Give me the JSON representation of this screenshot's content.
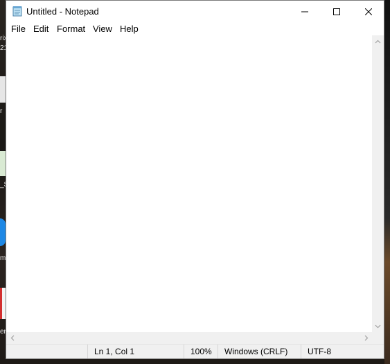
{
  "window": {
    "title": "Untitled - Notepad",
    "minimize_icon": "minimize-icon",
    "maximize_icon": "maximize-icon",
    "close_icon": "close-icon"
  },
  "menu": {
    "items": [
      "File",
      "Edit",
      "Format",
      "View",
      "Help"
    ]
  },
  "editor": {
    "content": ""
  },
  "status": {
    "position": "Ln 1, Col 1",
    "zoom": "100%",
    "line_ending": "Windows (CRLF)",
    "encoding": "UTF-8"
  },
  "desktop": {
    "fragments": [
      "rix",
      "21",
      "r",
      "_S",
      "m",
      "er"
    ]
  }
}
